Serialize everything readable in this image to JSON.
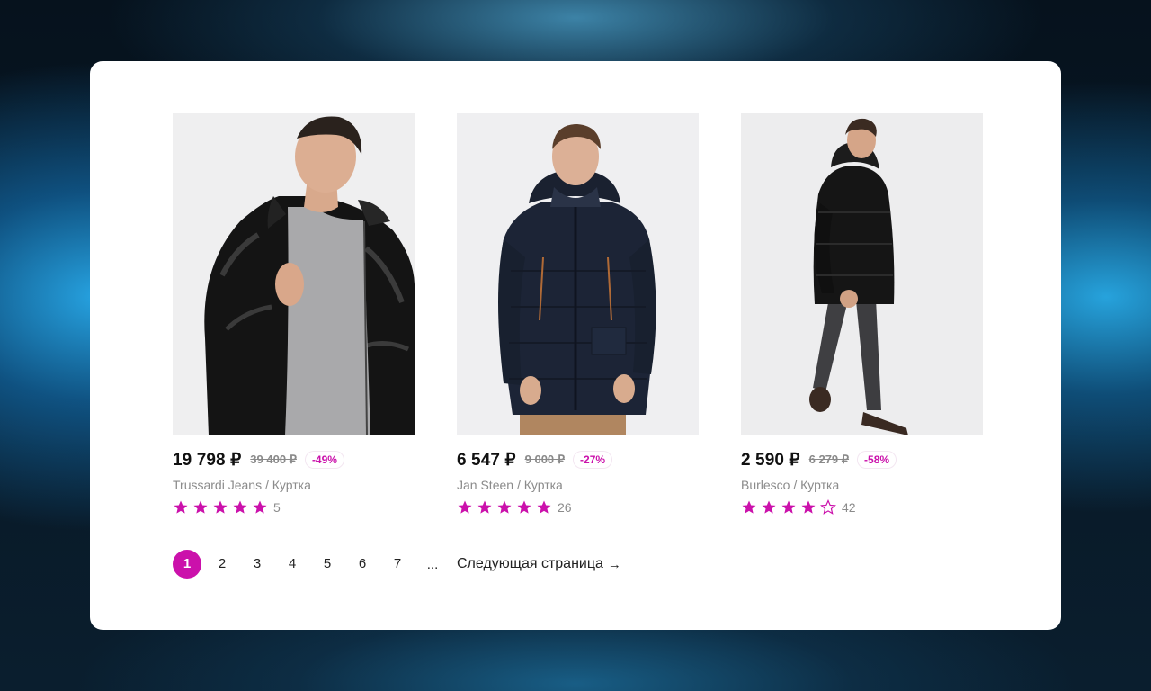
{
  "accent_color": "#cb11ab",
  "products": [
    {
      "price": "19 798 ₽",
      "old_price": "39 400 ₽",
      "discount": "-49%",
      "title": "Trussardi Jeans / Куртка",
      "rating": 5,
      "reviews": "5",
      "image": "man-in-shiny-black-puffer-jacket"
    },
    {
      "price": "6 547 ₽",
      "old_price": "9 000 ₽",
      "discount": "-27%",
      "title": "Jan Steen / Куртка",
      "rating": 5,
      "reviews": "26",
      "image": "man-in-navy-hooded-parka"
    },
    {
      "price": "2 590 ₽",
      "old_price": "6 279 ₽",
      "discount": "-58%",
      "title": "Burlesco / Куртка",
      "rating": 4,
      "reviews": "42",
      "image": "man-in-black-long-down-jacket"
    }
  ],
  "pagination": {
    "pages": [
      "1",
      "2",
      "3",
      "4",
      "5",
      "6",
      "7"
    ],
    "current": "1",
    "ellipsis": "...",
    "next_label": "Следующая страница",
    "next_icon": "→"
  }
}
